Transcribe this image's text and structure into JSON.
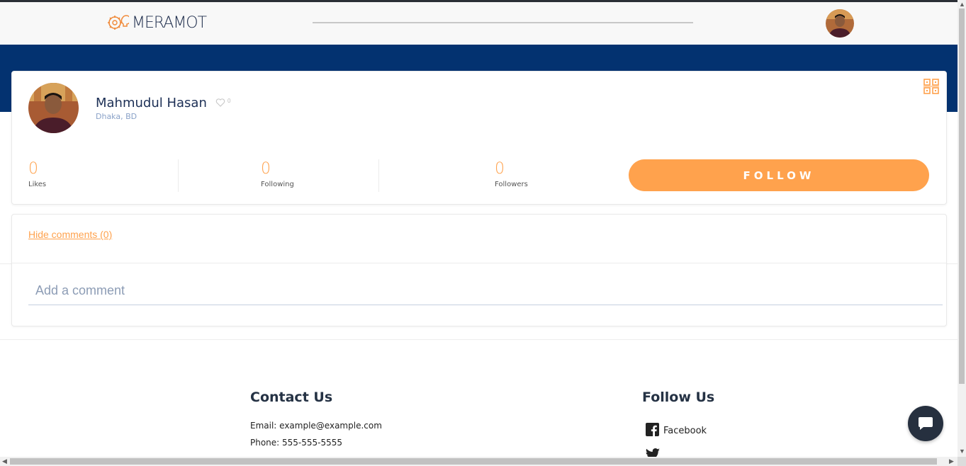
{
  "brand": {
    "logo_text": "MERAMOT",
    "accent": "#ffa24d",
    "navy": "#033270"
  },
  "profile": {
    "name": "Mahmudul Hasan",
    "likes_badge": "0",
    "location": "Dhaka, BD",
    "stats": [
      {
        "value": "0",
        "label": "Likes"
      },
      {
        "value": "0",
        "label": "Following"
      },
      {
        "value": "0",
        "label": "Followers"
      }
    ],
    "follow_label": "FOLLOW"
  },
  "comments": {
    "toggle_label": "Hide comments (0)",
    "input_placeholder": "Add a comment"
  },
  "footer": {
    "contact_heading": "Contact Us",
    "email_line": "Email: example@example.com",
    "phone_line": "Phone: 555-555-5555",
    "follow_heading": "Follow Us",
    "social": [
      {
        "icon": "facebook-icon",
        "label": "Facebook"
      },
      {
        "icon": "twitter-icon",
        "label": ""
      }
    ]
  },
  "icons": {
    "qr": "qr-code-icon",
    "chat": "chat-bubble-icon",
    "heart": "heart-icon",
    "logo": "lightbulb-gear-icon"
  }
}
